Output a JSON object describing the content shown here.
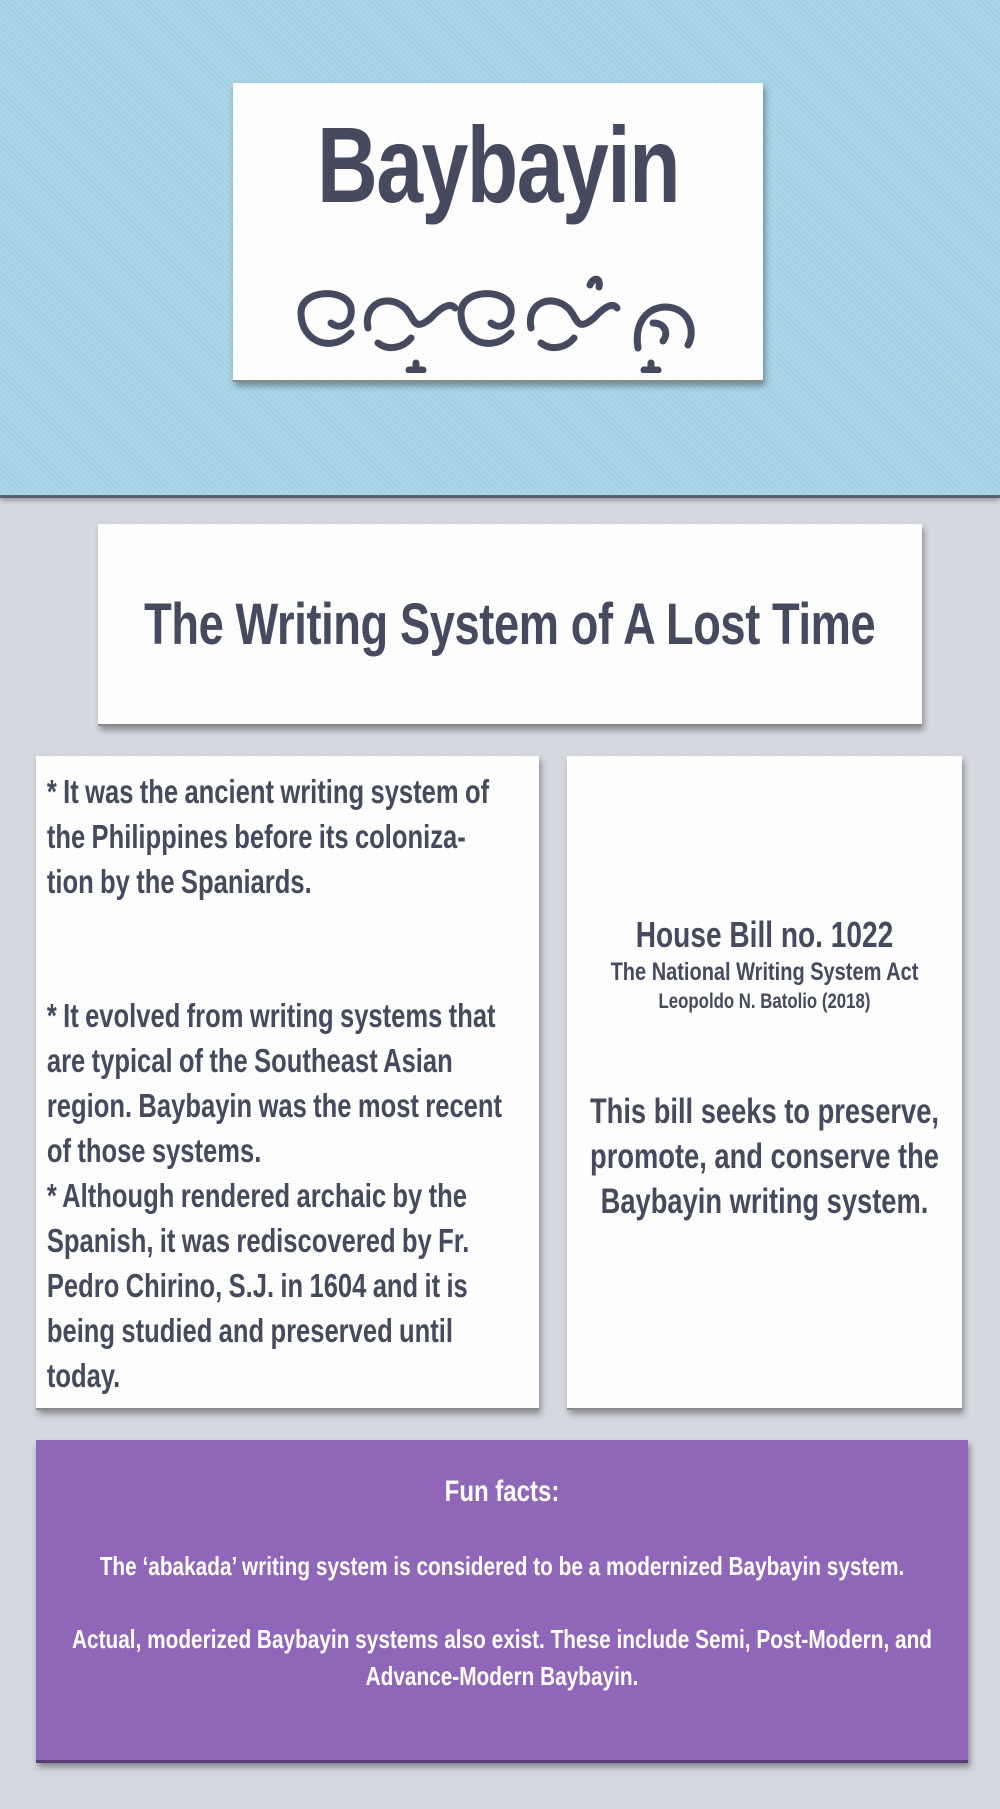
{
  "header": {
    "title": "Baybayin",
    "script_text": "ᜊᜌ᜔ᜊᜌᜒᜈ᜔",
    "script_icon": "baybayin-script-glyphs"
  },
  "subtitle": "The Writing System of A Lost Time",
  "facts_left": [
    "* It was the ancient writing system of the Philippines before its coloniza-tion by the Spaniards.",
    "* It evolved from writing systems that are typical of the Southeast Asian region. Baybayin was the most recent of those systems.",
    "* Although rendered archaic by the Spanish, it was rediscovered by Fr. Pedro Chirino, S.J. in 1604 and it is being studied and preserved until today."
  ],
  "bill": {
    "title": "House Bill no. 1022",
    "name": "The National Writing System Act",
    "author": "Leopoldo N. Batolio (2018)",
    "description": "This bill seeks to preserve, promote, and conserve the Baybayin writing system."
  },
  "fun_facts": {
    "title": "Fun facts:",
    "items": [
      "The ‘abakada’ writing system is considered to be a modernized Baybayin system.",
      "Actual, moderized Baybayin systems also exist. These include Semi, Post-Modern, and Advance-Modern Baybayin."
    ]
  },
  "colors": {
    "header_bg": "#a8d3e8",
    "page_bg": "#d5d8df",
    "text": "#464a5e",
    "facts_bg": "#9066b9"
  }
}
